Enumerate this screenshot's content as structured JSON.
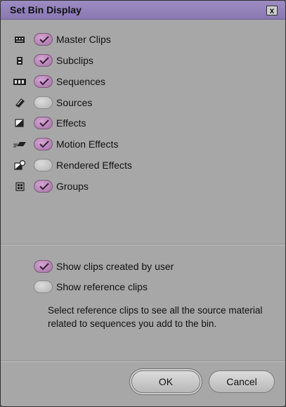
{
  "window": {
    "title": "Set Bin Display",
    "close_label": "x"
  },
  "bin_items": [
    {
      "label": "Master Clips",
      "checked": true,
      "icon": "master-clip-icon"
    },
    {
      "label": "Subclips",
      "checked": true,
      "icon": "subclip-icon"
    },
    {
      "label": "Sequences",
      "checked": true,
      "icon": "sequence-icon"
    },
    {
      "label": "Sources",
      "checked": false,
      "icon": "source-icon"
    },
    {
      "label": "Effects",
      "checked": true,
      "icon": "effect-icon"
    },
    {
      "label": "Motion Effects",
      "checked": true,
      "icon": "motion-effect-icon"
    },
    {
      "label": "Rendered Effects",
      "checked": false,
      "icon": "rendered-effect-icon"
    },
    {
      "label": "Groups",
      "checked": true,
      "icon": "group-icon"
    }
  ],
  "options": [
    {
      "label": "Show clips created by user",
      "checked": true
    },
    {
      "label": "Show reference clips",
      "checked": false
    }
  ],
  "help_text": "Select reference clips to see all the source material related to sequences you add to the bin.",
  "buttons": {
    "ok_label": "OK",
    "cancel_label": "Cancel"
  },
  "colors": {
    "title_bar": "#9583ba",
    "checked": "#b885b8",
    "unchecked": "#cccccc",
    "dialog_bg": "#a7a7a7"
  }
}
